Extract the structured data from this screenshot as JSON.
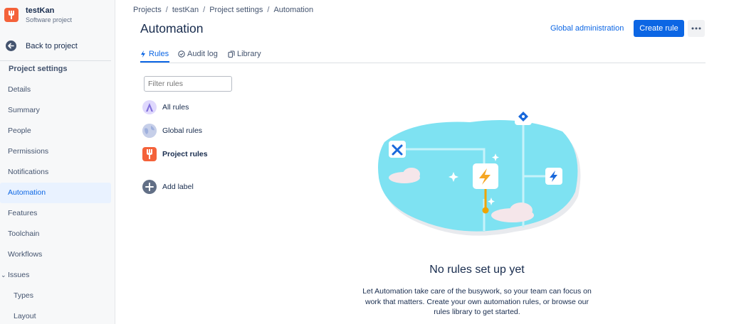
{
  "project": {
    "name": "testKan",
    "type": "Software project"
  },
  "sidebar": {
    "back_label": "Back to project",
    "section_title": "Project settings",
    "items": [
      {
        "label": "Details"
      },
      {
        "label": "Summary"
      },
      {
        "label": "People"
      },
      {
        "label": "Permissions"
      },
      {
        "label": "Notifications"
      },
      {
        "label": "Automation",
        "active": true
      },
      {
        "label": "Features"
      },
      {
        "label": "Toolchain"
      },
      {
        "label": "Workflows"
      },
      {
        "label": "Issues",
        "expanded": true
      },
      {
        "label": "Types"
      },
      {
        "label": "Layout"
      }
    ]
  },
  "breadcrumb": [
    "Projects",
    "testKan",
    "Project settings",
    "Automation"
  ],
  "header": {
    "title": "Automation",
    "global_admin_label": "Global administration",
    "create_rule_label": "Create rule"
  },
  "tabs": [
    {
      "label": "Rules",
      "icon": "lightning-icon",
      "active": true
    },
    {
      "label": "Audit log",
      "icon": "check-circle-icon"
    },
    {
      "label": "Library",
      "icon": "copy-icon"
    }
  ],
  "filter": {
    "placeholder": "Filter rules"
  },
  "rule_groups": [
    {
      "label": "All rules",
      "icon": "all-rules-icon"
    },
    {
      "label": "Global rules",
      "icon": "globe-icon"
    },
    {
      "label": "Project rules",
      "icon": "project-icon",
      "active": true
    },
    {
      "label": "Add label",
      "icon": "plus-icon"
    }
  ],
  "empty_state": {
    "title": "No rules set up yet",
    "description": "Let Automation take care of the busywork, so your team can focus on work that matters. Create your own automation rules, or browse our rules library to get started."
  },
  "colors": {
    "accent": "#0c66e4",
    "project_avatar": "#f4623a",
    "active_nav_bg": "#e9f2ff"
  }
}
